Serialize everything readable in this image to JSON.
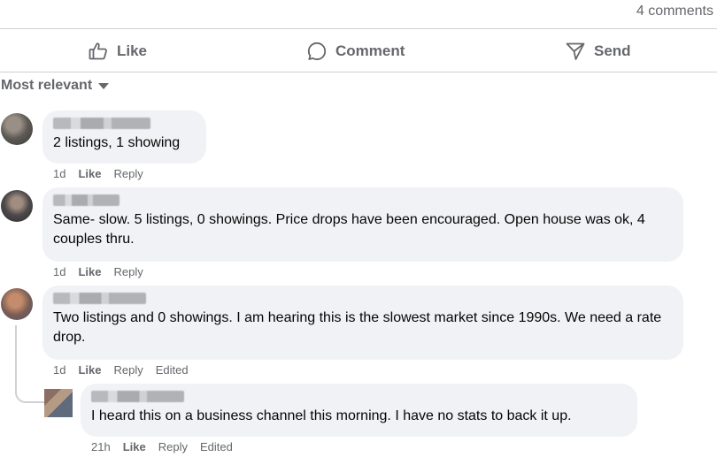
{
  "header": {
    "comments_count": "4 comments"
  },
  "actions": {
    "like": "Like",
    "comment": "Comment",
    "send": "Send"
  },
  "sort": {
    "label": "Most relevant"
  },
  "comments": [
    {
      "text": "2 listings, 1 showing",
      "time": "1d",
      "like": "Like",
      "reply": "Reply"
    },
    {
      "text": "Same- slow. 5 listings, 0 showings. Price drops have been encouraged. Open house was ok, 4 couples thru.",
      "time": "1d",
      "like": "Like",
      "reply": "Reply"
    },
    {
      "text": "Two listings and 0 showings. I am hearing this is the slowest market since 1990s. We need a rate drop.",
      "time": "1d",
      "like": "Like",
      "reply": "Reply",
      "edited": "Edited"
    }
  ],
  "reply": {
    "text": "I heard this on a business channel this morning. I have no stats to back it up.",
    "time": "21h",
    "like": "Like",
    "reply": "Reply",
    "edited": "Edited"
  }
}
